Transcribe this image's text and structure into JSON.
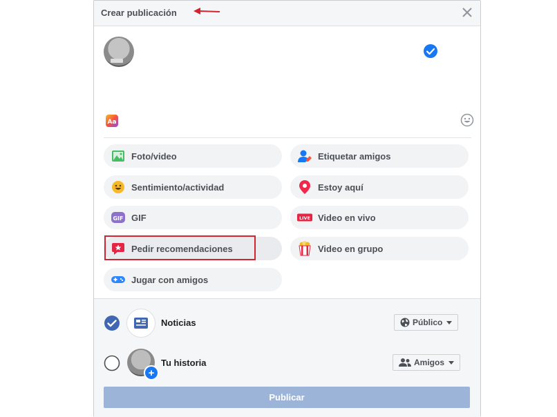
{
  "dialog": {
    "title": "Crear publicación",
    "compose_placeholder": ""
  },
  "options": [
    {
      "label": "Foto/video",
      "icon": "photo-icon"
    },
    {
      "label": "Etiquetar amigos",
      "icon": "tag-friends-icon"
    },
    {
      "label": "Sentimiento/actividad",
      "icon": "smiley-icon"
    },
    {
      "label": "Estoy aquí",
      "icon": "location-pin-icon"
    },
    {
      "label": "GIF",
      "icon": "gif-icon"
    },
    {
      "label": "Video en vivo",
      "icon": "live-icon"
    },
    {
      "label": "Pedir recomendaciones",
      "icon": "recommendation-icon"
    },
    {
      "label": "Video en grupo",
      "icon": "popcorn-icon"
    },
    {
      "label": "Jugar con amigos",
      "icon": "game-controller-icon"
    }
  ],
  "footer": {
    "news_feed": {
      "label": "Noticias",
      "checked": true,
      "audience": "Público"
    },
    "story": {
      "label": "Tu historia",
      "checked": false,
      "audience": "Amigos"
    },
    "publish_label": "Publicar"
  },
  "colors": {
    "accent": "#1877f2",
    "publish_disabled": "#9cb4d8",
    "highlight": "#d3232e"
  }
}
